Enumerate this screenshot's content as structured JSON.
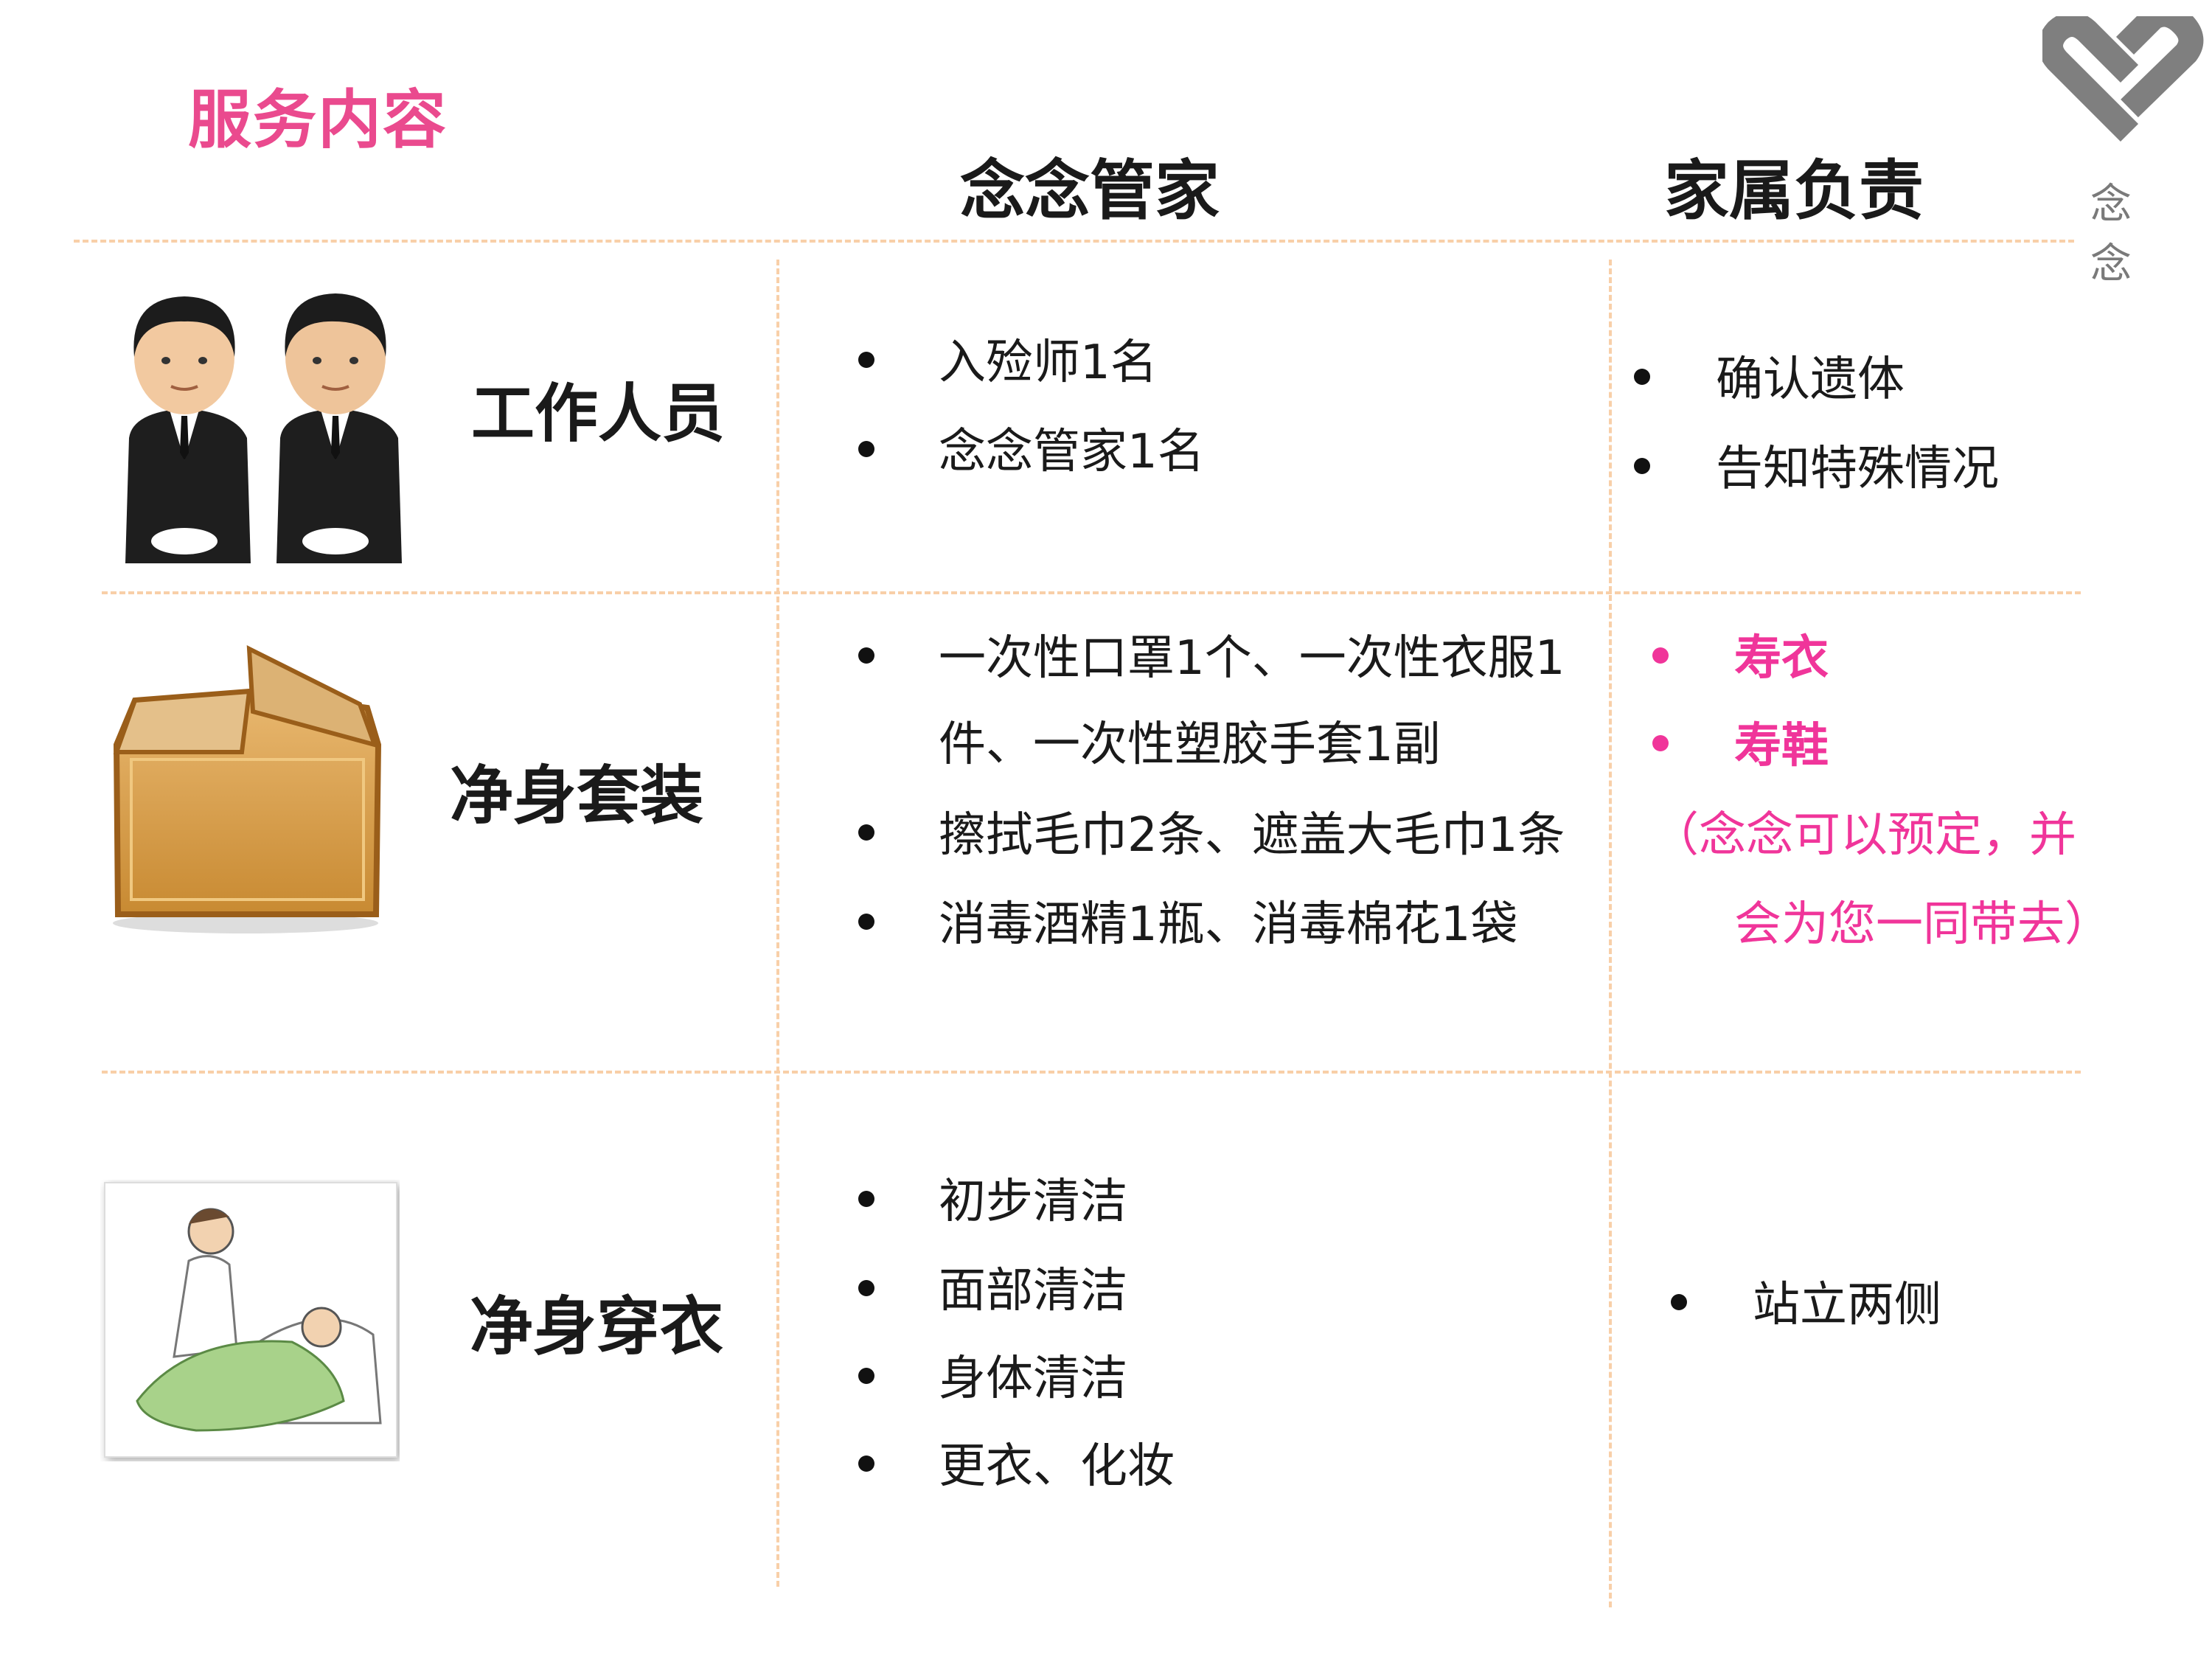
{
  "page_title": "服务内容",
  "logo": {
    "text": "念念",
    "color": "#7f7f7f"
  },
  "columns": {
    "provider": "念念管家",
    "family": "家属负责"
  },
  "colors": {
    "accent_pink": "#f0359a",
    "title_pink": "#ea4a8e",
    "divider": "#f8cfa8"
  },
  "rows": [
    {
      "label": "工作人员",
      "image": "staff-illustration",
      "provider_items": [
        "入殓师1名",
        "念念管家1名"
      ],
      "family_items": [
        "确认遗体",
        "告知特殊情况"
      ]
    },
    {
      "label": "净身套装",
      "image": "cardboard-box-illustration",
      "provider_items": [
        "一次性口罩1个、一次性衣服1",
        "件、一次性塑胶手套1副",
        "擦拭毛巾2条、遮盖大毛巾1条",
        "消毒酒精1瓶、消毒棉花1袋"
      ],
      "family_items": [
        "寿衣",
        "寿鞋"
      ],
      "family_note": [
        "（念念可以预定，并",
        "会为您一同带去）"
      ]
    },
    {
      "label": "净身穿衣",
      "image": "bedside-care-illustration",
      "provider_items": [
        "初步清洁",
        "面部清洁",
        "身体清洁",
        "更衣、化妆"
      ],
      "family_items": [
        "站立两侧"
      ]
    }
  ]
}
